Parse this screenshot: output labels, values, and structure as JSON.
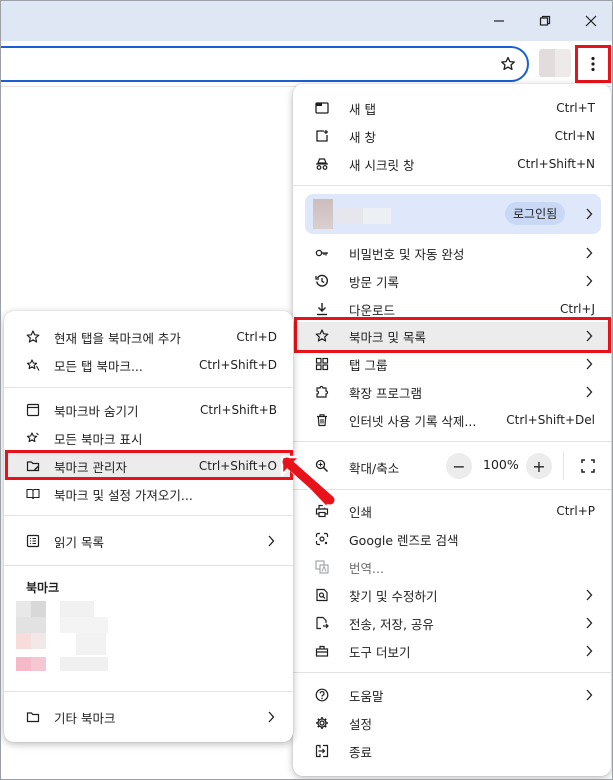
{
  "main_menu": {
    "items": [
      {
        "label": "새 탭",
        "shortcut": "Ctrl+T",
        "icon": "new-tab-icon"
      },
      {
        "label": "새 창",
        "shortcut": "Ctrl+N",
        "icon": "new-window-icon"
      },
      {
        "label": "새 시크릿 창",
        "shortcut": "Ctrl+Shift+N",
        "icon": "incognito-icon"
      }
    ],
    "profile": {
      "login_label": "로그인됨"
    },
    "items2": [
      {
        "label": "비밀번호 및 자동 완성",
        "icon": "key-icon"
      },
      {
        "label": "방문 기록",
        "icon": "history-icon"
      },
      {
        "label": "다운로드",
        "shortcut": "Ctrl+J",
        "icon": "download-icon"
      },
      {
        "label": "북마크 및 목록",
        "icon": "bookmark-star-icon"
      },
      {
        "label": "탭 그룹",
        "icon": "tab-groups-icon"
      },
      {
        "label": "확장 프로그램",
        "icon": "extensions-icon"
      },
      {
        "label": "인터넷 사용 기록 삭제...",
        "shortcut": "Ctrl+Shift+Del",
        "icon": "trash-icon"
      }
    ],
    "zoom": {
      "label": "확대/축소",
      "minus": "−",
      "value": "100%",
      "plus": "+"
    },
    "items3": [
      {
        "label": "인쇄",
        "shortcut": "Ctrl+P",
        "icon": "print-icon"
      },
      {
        "label": "Google 렌즈로 검색",
        "icon": "lens-icon"
      },
      {
        "label": "번역...",
        "icon": "translate-icon"
      },
      {
        "label": "찾기 및 수정하기",
        "icon": "find-icon"
      },
      {
        "label": "전송, 저장, 공유",
        "icon": "share-icon"
      },
      {
        "label": "도구 더보기",
        "icon": "tools-icon"
      }
    ],
    "items4": [
      {
        "label": "도움말",
        "icon": "help-icon"
      },
      {
        "label": "설정",
        "icon": "settings-icon"
      },
      {
        "label": "종료",
        "icon": "exit-icon"
      }
    ]
  },
  "bookmark_submenu": {
    "items": [
      {
        "label": "현재 탭을 북마크에 추가",
        "shortcut": "Ctrl+D",
        "icon": "star-icon"
      },
      {
        "label": "모든 탭 북마크...",
        "shortcut": "Ctrl+Shift+D",
        "icon": "stars-icon"
      },
      {
        "label": "북마크바 숨기기",
        "shortcut": "Ctrl+Shift+B",
        "icon": "bookmark-bar-icon"
      },
      {
        "label": "모든 북마크 표시",
        "icon": "all-bookmarks-icon"
      },
      {
        "label": "북마크 관리자",
        "shortcut": "Ctrl+Shift+O",
        "icon": "folder-edit-icon"
      },
      {
        "label": "북마크 및 설정 가져오기...",
        "icon": "import-icon"
      },
      {
        "label": "읽기 목록",
        "icon": "reading-list-icon"
      }
    ],
    "section_header": "북마크",
    "other_bookmarks": "기타 북마크"
  },
  "colors": {
    "highlight": "#e8121a",
    "accent": "#1a5fd4",
    "titlebar": "#dfe7f5"
  }
}
